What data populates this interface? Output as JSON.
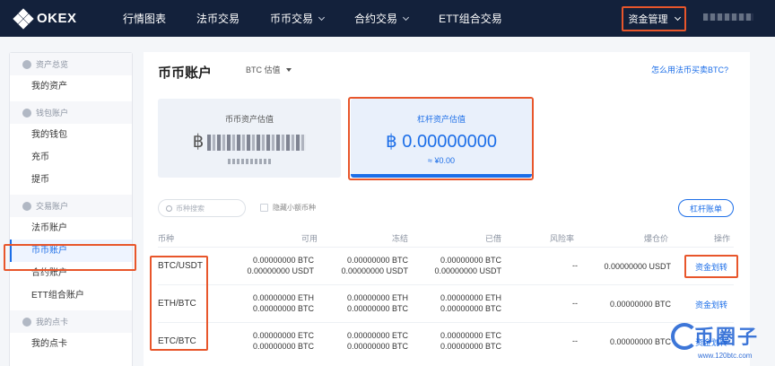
{
  "nav": {
    "brand": "OKEX",
    "items": [
      {
        "label": "行情图表",
        "dropdown": false
      },
      {
        "label": "法币交易",
        "dropdown": false
      },
      {
        "label": "币币交易",
        "dropdown": true
      },
      {
        "label": "合约交易",
        "dropdown": true
      },
      {
        "label": "ETT组合交易",
        "dropdown": false
      }
    ],
    "fund_management": "资金管理"
  },
  "sidebar": {
    "sections": [
      {
        "title": "资产总览",
        "items": [
          "我的资产"
        ]
      },
      {
        "title": "钱包账户",
        "items": [
          "我的钱包",
          "充币",
          "提币"
        ]
      },
      {
        "title": "交易账户",
        "items": [
          "法币账户",
          "币币账户",
          "合约账户",
          "ETT组合账户"
        ]
      },
      {
        "title": "我的点卡",
        "items": [
          "我的点卡"
        ]
      }
    ],
    "active_item": "币币账户"
  },
  "main": {
    "title": "币币账户",
    "valuation_select": "BTC 估值",
    "help_link": "怎么用法币买卖BTC?",
    "spot_card": {
      "label": "币币资产估值",
      "currency": "฿"
    },
    "margin_card": {
      "label": "杠杆资产估值",
      "value": "฿ 0.00000000",
      "sub": "≈ ¥0.00"
    },
    "search_placeholder": "币种搜索",
    "hide_small": "隐藏小额币种",
    "margin_bill": "杠杆账单",
    "columns": [
      "币种",
      "可用",
      "冻结",
      "已借",
      "风险率",
      "爆仓价",
      "操作"
    ],
    "rows": [
      {
        "pair": "BTC/USDT",
        "available": [
          "0.00000000 BTC",
          "0.00000000 USDT"
        ],
        "frozen": [
          "0.00000000 BTC",
          "0.00000000 USDT"
        ],
        "borrowed": [
          "0.00000000 BTC",
          "0.00000000 USDT"
        ],
        "risk": "--",
        "liq_price": "0.00000000 USDT",
        "action": "资金划转"
      },
      {
        "pair": "ETH/BTC",
        "available": [
          "0.00000000 ETH",
          "0.00000000 BTC"
        ],
        "frozen": [
          "0.00000000 ETH",
          "0.00000000 BTC"
        ],
        "borrowed": [
          "0.00000000 ETH",
          "0.00000000 BTC"
        ],
        "risk": "--",
        "liq_price": "0.00000000 BTC",
        "action": "资金划转"
      },
      {
        "pair": "ETC/BTC",
        "available": [
          "0.00000000 ETC",
          "0.00000000 BTC"
        ],
        "frozen": [
          "0.00000000 ETC",
          "0.00000000 BTC"
        ],
        "borrowed": [
          "0.00000000 ETC",
          "0.00000000 BTC"
        ],
        "risk": "--",
        "liq_price": "0.00000000 BTC",
        "action": "资金划转"
      }
    ]
  },
  "watermark": {
    "text": "币圈子",
    "url": "www.120btc.com"
  },
  "colors": {
    "nav_bg": "#13213b",
    "accent": "#1c6ee8",
    "highlight": "#e8562b"
  }
}
